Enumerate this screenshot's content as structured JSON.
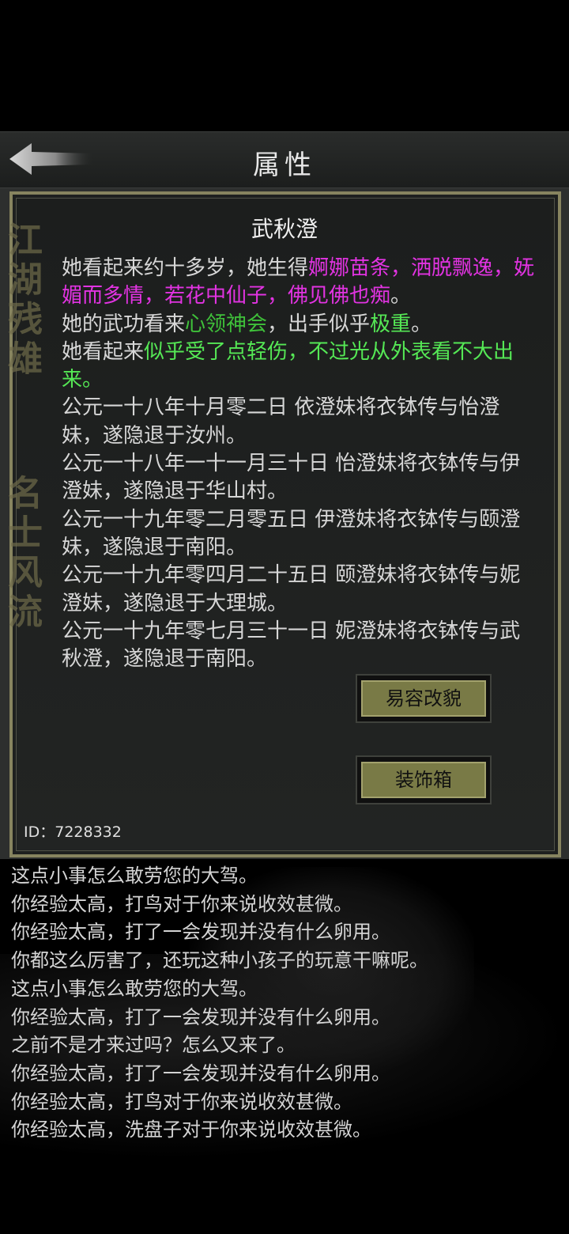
{
  "header": {
    "back_icon": "back-arrow-icon",
    "title": "属性"
  },
  "panel": {
    "calligraphy_1": "江湖残雄",
    "calligraphy_2": "名士风流",
    "character_name": "武秋澄",
    "appearance": {
      "prefix": "她看起来约十多岁，她生得",
      "traits": "婀娜苗条，洒脱飘逸，妩媚而多情，若花中仙子，佛见佛也痴",
      "suffix": "。"
    },
    "martial": {
      "prefix": "她的武功看来",
      "skill": "心领神会",
      "middle": "，出手似乎",
      "strength": "极重",
      "suffix": "。"
    },
    "health": {
      "prefix": "她看起来",
      "status": "似乎受了点轻伤，不过光从外表看不大出来。"
    },
    "history": [
      "公元一十八年十月零二日 依澄妹将衣钵传与怡澄妹，遂隐退于汝州。",
      "公元一十八年一十一月三十日 怡澄妹将衣钵传与伊澄妹，遂隐退于华山村。",
      "公元一十九年零二月零五日 伊澄妹将衣钵传与颐澄妹，遂隐退于南阳。",
      "公元一十九年零四月二十五日 颐澄妹将衣钵传与妮澄妹，遂隐退于大理城。",
      "公元一十九年零七月三十一日 妮澄妹将衣钵传与武秋澄，遂隐退于南阳。"
    ],
    "buttons": {
      "disguise": "易容改貌",
      "wardrobe": "装饰箱"
    },
    "id_text": "ID：7228332"
  },
  "log": [
    "这点小事怎么敢劳您的大驾。",
    "你经验太高，打鸟对于你来说收效甚微。",
    "你经验太高，打了一会发现并没有什么卵用。",
    "你都这么厉害了，还玩这种小孩子的玩意干嘛呢。",
    "这点小事怎么敢劳您的大驾。",
    "你经验太高，打了一会发现并没有什么卵用。",
    "之前不是才来过吗？怎么又来了。",
    "你经验太高，打了一会发现并没有什么卵用。",
    "你经验太高，打鸟对于你来说收效甚微。",
    "你经验太高，洗盘子对于你来说收效甚微。"
  ],
  "colors": {
    "accent_magenta": "#e233e2",
    "accent_green": "#55e855",
    "skill_green": "#3fc13a",
    "panel_border": "#87845f",
    "button_face": "#797a46"
  }
}
